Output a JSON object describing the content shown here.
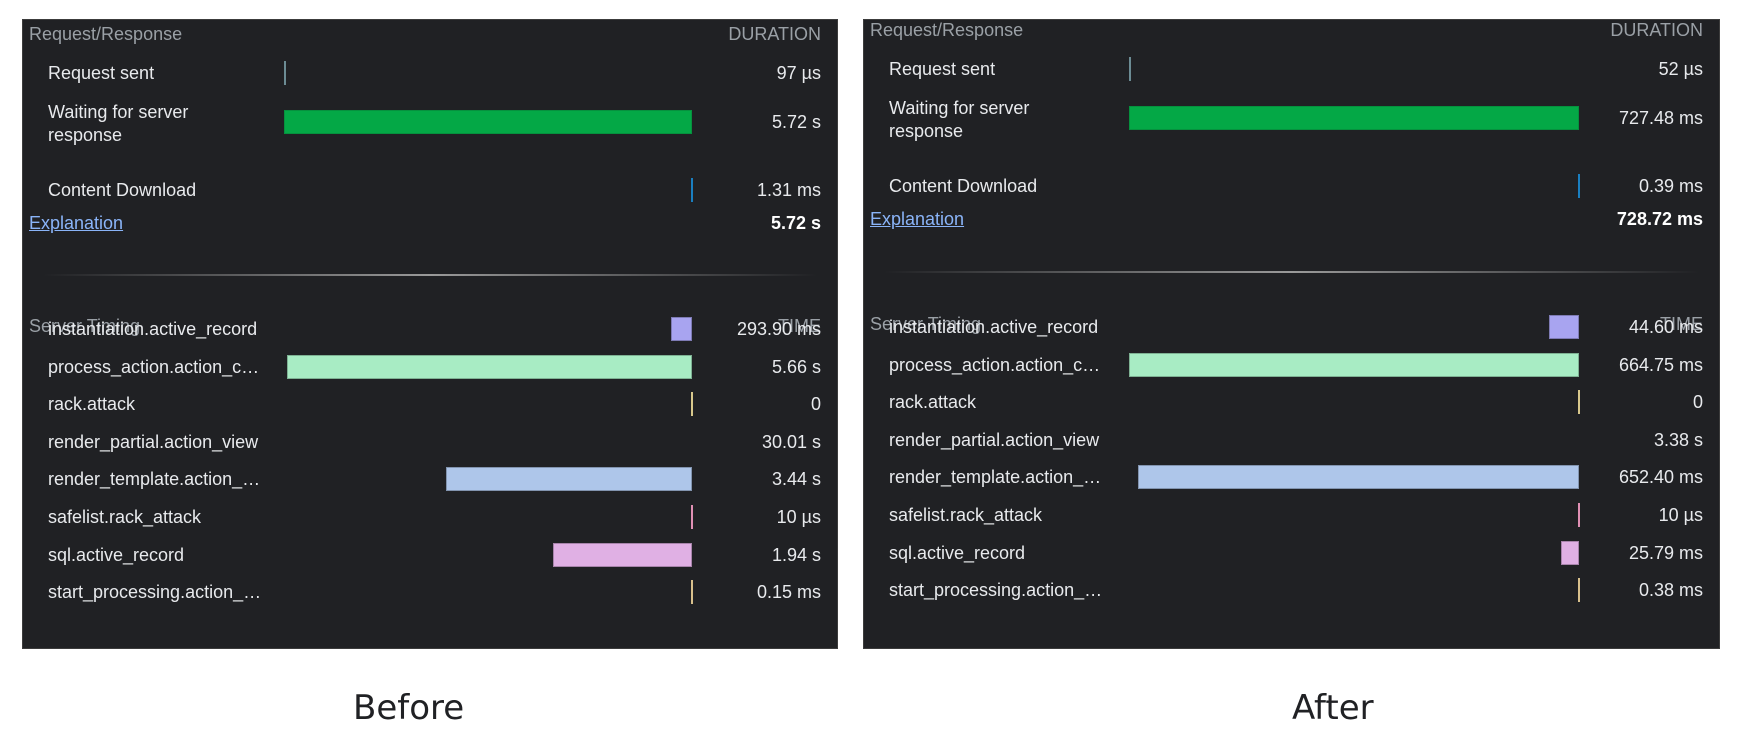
{
  "colors": {
    "panel_bg": "#202124",
    "header_text": "#9aa0a6",
    "link": "#8ab4f8",
    "waiting_bar": "#04a846",
    "request_tick": "#6c8c94",
    "download_tick": "#1a7fc0",
    "instantiation": "#a8a4f0",
    "process_action": "#a8ecc4",
    "rack_attack": "#d8c88c",
    "render_template": "#aec6ea",
    "safelist": "#e090b4",
    "sql": "#e0b0e4",
    "start_processing": "#d8c08c"
  },
  "panels": [
    {
      "caption": "Before",
      "request_response": {
        "title": "Request/Response",
        "column": "DURATION",
        "rows": [
          {
            "label": "Request sent",
            "value": "97 µs",
            "fraction": 0.0
          },
          {
            "label": "Waiting for server response",
            "value": "5.72 s",
            "fraction": 1.0
          },
          {
            "label": "Content Download",
            "value": "1.31 ms",
            "fraction": 0.0
          }
        ],
        "explanation_link": "Explanation",
        "total": "5.72 s"
      },
      "server_timing": {
        "title": "Server Timing",
        "column": "TIME",
        "rows": [
          {
            "label": "instantiation.active_record",
            "value": "293.90 ms",
            "fraction": 0.052
          },
          {
            "label": "process_action.action_c…",
            "value": "5.66 s",
            "fraction": 1.0
          },
          {
            "label": "rack.attack",
            "value": "0",
            "fraction": 0.0
          },
          {
            "label": "render_partial.action_view",
            "value": "30.01 s",
            "fraction": null
          },
          {
            "label": "render_template.action_…",
            "value": "3.44 s",
            "fraction": 0.608
          },
          {
            "label": "safelist.rack_attack",
            "value": "10 µs",
            "fraction": 0.0
          },
          {
            "label": "sql.active_record",
            "value": "1.94 s",
            "fraction": 0.343
          },
          {
            "label": "start_processing.action_…",
            "value": "0.15 ms",
            "fraction": 0.0
          }
        ]
      }
    },
    {
      "caption": "After",
      "request_response": {
        "title": "Request/Response",
        "column": "DURATION",
        "rows": [
          {
            "label": "Request sent",
            "value": "52 µs",
            "fraction": 0.0
          },
          {
            "label": "Waiting for server response",
            "value": "727.48 ms",
            "fraction": 1.0
          },
          {
            "label": "Content Download",
            "value": "0.39 ms",
            "fraction": 0.0
          }
        ],
        "explanation_link": "Explanation",
        "total": "728.72 ms"
      },
      "server_timing": {
        "title": "Server Timing",
        "column": "TIME",
        "rows": [
          {
            "label": "instantiation.active_record",
            "value": "44.60 ms",
            "fraction": 0.067
          },
          {
            "label": "process_action.action_c…",
            "value": "664.75 ms",
            "fraction": 1.0
          },
          {
            "label": "rack.attack",
            "value": "0",
            "fraction": 0.0
          },
          {
            "label": "render_partial.action_view",
            "value": "3.38 s",
            "fraction": null
          },
          {
            "label": "render_template.action_…",
            "value": "652.40 ms",
            "fraction": 0.981
          },
          {
            "label": "safelist.rack_attack",
            "value": "10 µs",
            "fraction": 0.0
          },
          {
            "label": "sql.active_record",
            "value": "25.79 ms",
            "fraction": 0.039
          },
          {
            "label": "start_processing.action_…",
            "value": "0.38 ms",
            "fraction": 0.0
          }
        ]
      }
    }
  ]
}
